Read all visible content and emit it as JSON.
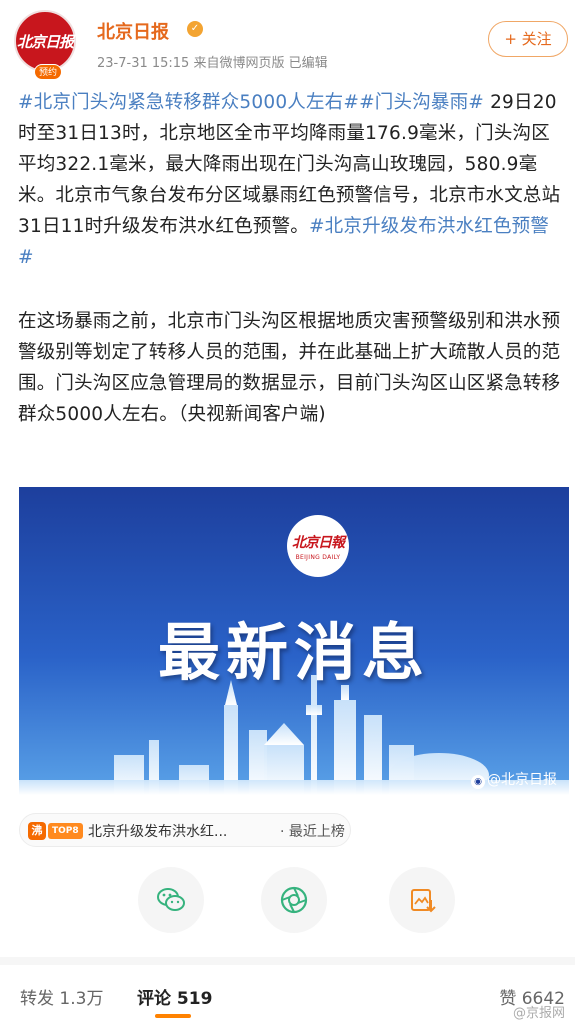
{
  "header": {
    "author": "北京日报",
    "avatar_text": "北京日报",
    "avatar_badge": "预约",
    "meta": "23-7-31 15:15  来自微博网页版  已编辑",
    "follow_label": "+ 关注",
    "verify_icon": "verified-gold-icon"
  },
  "post": {
    "tag1": "#北京门头沟紧急转移群众5000人左右#",
    "tag2": "#门头沟暴雨#",
    "body1": " 29日20时至31日13时，北京地区全市平均降雨量176.9毫米，门头沟区平均322.1毫米，最大降雨出现在门头沟高山玫瑰园，580.9毫米。北京市气象台发布分区域暴雨红色预警信号，北京市水文总站31日11时升级发布洪水红色预警。",
    "tag3": "#北京升级发布洪水红色预警#",
    "body2": "在这场暴雨之前，北京市门头沟区根据地质灾害预警级别和洪水预警级别等划定了转移人员的范围，并在此基础上扩大疏散人员的范围。门头沟区应急管理局的数据显示，目前门头沟区山区紧急转移群众5000人左右。（央视新闻客户端)"
  },
  "image": {
    "logo_cn": "北京日報",
    "logo_en": "BEIJING DAILY",
    "headline": "最新消息",
    "watermark": "@北京日报"
  },
  "trend": {
    "icon": "沸",
    "badge": "TOP8",
    "text": "北京升级发布洪水红...",
    "status": "· 最近上榜"
  },
  "share": {
    "icons": [
      "wechat-icon",
      "moments-icon",
      "save-image-icon"
    ]
  },
  "bottom": {
    "repost": "转发 1.3万",
    "comment": "评论 519",
    "like": "赞 6642",
    "corner_mark": "@京报网"
  },
  "colors": {
    "accent": "#e5691d",
    "link": "#4a7fc1",
    "tab_underline": "#ff8200"
  }
}
